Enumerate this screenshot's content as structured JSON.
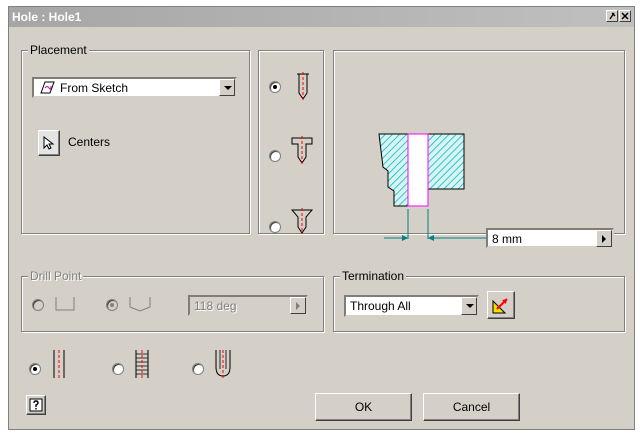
{
  "window": {
    "title": "Hole : Hole1"
  },
  "placement": {
    "legend": "Placement",
    "mode_value": "From Sketch",
    "centers_label": "Centers"
  },
  "drill_point": {
    "legend": "Drill Point",
    "angle_value": "118 deg"
  },
  "termination": {
    "legend": "Termination",
    "value": "Through All"
  },
  "preview": {
    "diameter_value": "8 mm"
  },
  "buttons": {
    "ok": "OK",
    "cancel": "Cancel"
  },
  "colors": {
    "hatch": "#00b8b8",
    "hole": "#ff00ff",
    "dimension": "#008080",
    "centerline": "#ff0000"
  },
  "icons": {
    "help": "help-icon",
    "centers": "cursor-arrow-icon",
    "sketch": "sketch-icon",
    "flip": "flip-direction-icon"
  }
}
